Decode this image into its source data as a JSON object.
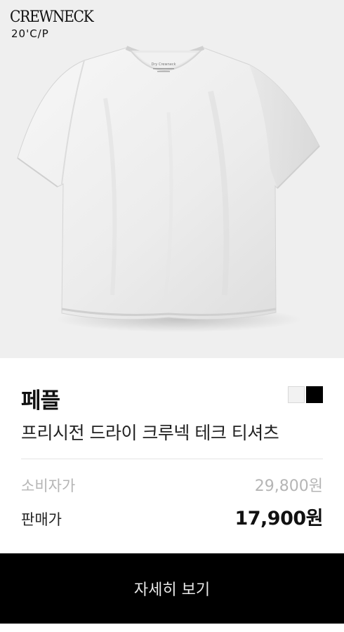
{
  "hero": {
    "brand_mark": "CREWNECK",
    "fabric_spec": "20'C/P",
    "shirt_neck_label": "Dry Crewneck"
  },
  "product": {
    "brand": "페플",
    "name": "프리시전 드라이 크루넥 테크 티셔츠",
    "swatches": [
      {
        "name": "white",
        "color": "#f2f2f2"
      },
      {
        "name": "black",
        "color": "#000000"
      }
    ]
  },
  "pricing": {
    "msrp_label": "소비자가",
    "msrp_value": "29,800원",
    "sale_label": "판매가",
    "sale_value": "17,900원"
  },
  "cta": {
    "label": "자세히 보기"
  },
  "colors": {
    "hero_bg": "#efefef",
    "button_bg": "#000000",
    "muted_text": "#b5b5b5"
  }
}
